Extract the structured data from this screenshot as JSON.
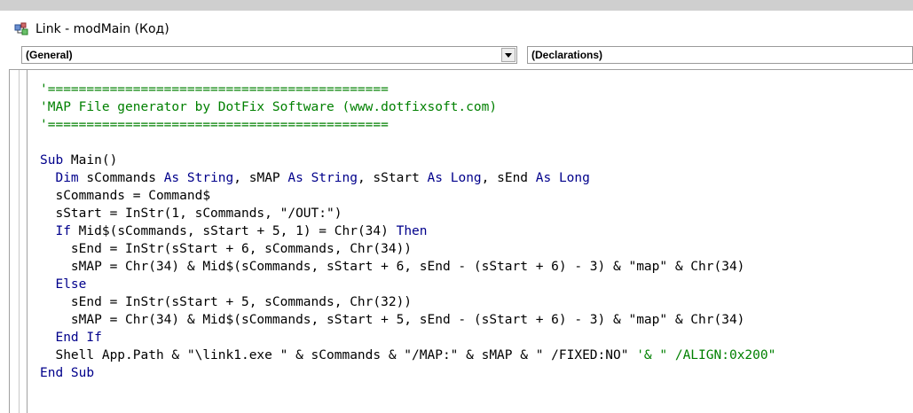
{
  "window": {
    "title": "Link - modMain (Код)",
    "icon": "vba-module-icon"
  },
  "combos": {
    "object": "(General)",
    "procedure": "(Declarations)"
  },
  "colors": {
    "keyword": "#00008b",
    "comment": "#008000",
    "text": "#000000"
  },
  "code": {
    "lines": [
      [
        {
          "t": "'============================================",
          "c": "cm"
        }
      ],
      [
        {
          "t": "'MAP File generator by DotFix Software (www.dotfixsoft.com)",
          "c": "cm"
        }
      ],
      [
        {
          "t": "'============================================",
          "c": "cm"
        }
      ],
      [],
      [
        {
          "t": "Sub",
          "c": "kw"
        },
        {
          "t": " Main()",
          "c": ""
        }
      ],
      [
        {
          "t": "  ",
          "c": ""
        },
        {
          "t": "Dim",
          "c": "kw"
        },
        {
          "t": " sCommands ",
          "c": ""
        },
        {
          "t": "As String",
          "c": "kw"
        },
        {
          "t": ", sMAP ",
          "c": ""
        },
        {
          "t": "As String",
          "c": "kw"
        },
        {
          "t": ", sStart ",
          "c": ""
        },
        {
          "t": "As Long",
          "c": "kw"
        },
        {
          "t": ", sEnd ",
          "c": ""
        },
        {
          "t": "As Long",
          "c": "kw"
        }
      ],
      [
        {
          "t": "  sCommands = Command$",
          "c": ""
        }
      ],
      [
        {
          "t": "  sStart = InStr(1, sCommands, \"/OUT:\")",
          "c": ""
        }
      ],
      [
        {
          "t": "  ",
          "c": ""
        },
        {
          "t": "If",
          "c": "kw"
        },
        {
          "t": " Mid$(sCommands, sStart + 5, 1) = Chr(34) ",
          "c": ""
        },
        {
          "t": "Then",
          "c": "kw"
        }
      ],
      [
        {
          "t": "    sEnd = InStr(sStart + 6, sCommands, Chr(34))",
          "c": ""
        }
      ],
      [
        {
          "t": "    sMAP = Chr(34) & Mid$(sCommands, sStart + 6, sEnd - (sStart + 6) - 3) & \"map\" & Chr(34)",
          "c": ""
        }
      ],
      [
        {
          "t": "  ",
          "c": ""
        },
        {
          "t": "Else",
          "c": "kw"
        }
      ],
      [
        {
          "t": "    sEnd = InStr(sStart + 5, sCommands, Chr(32))",
          "c": ""
        }
      ],
      [
        {
          "t": "    sMAP = Chr(34) & Mid$(sCommands, sStart + 5, sEnd - (sStart + 6) - 3) & \"map\" & Chr(34)",
          "c": ""
        }
      ],
      [
        {
          "t": "  ",
          "c": ""
        },
        {
          "t": "End If",
          "c": "kw"
        }
      ],
      [
        {
          "t": "  Shell App.Path & \"\\link1.exe \" & sCommands & \"/MAP:\" & sMAP & \" /FIXED:NO\" ",
          "c": ""
        },
        {
          "t": "'& \" /ALIGN:0x200\"",
          "c": "cm"
        }
      ],
      [
        {
          "t": "End Sub",
          "c": "kw"
        }
      ]
    ]
  }
}
